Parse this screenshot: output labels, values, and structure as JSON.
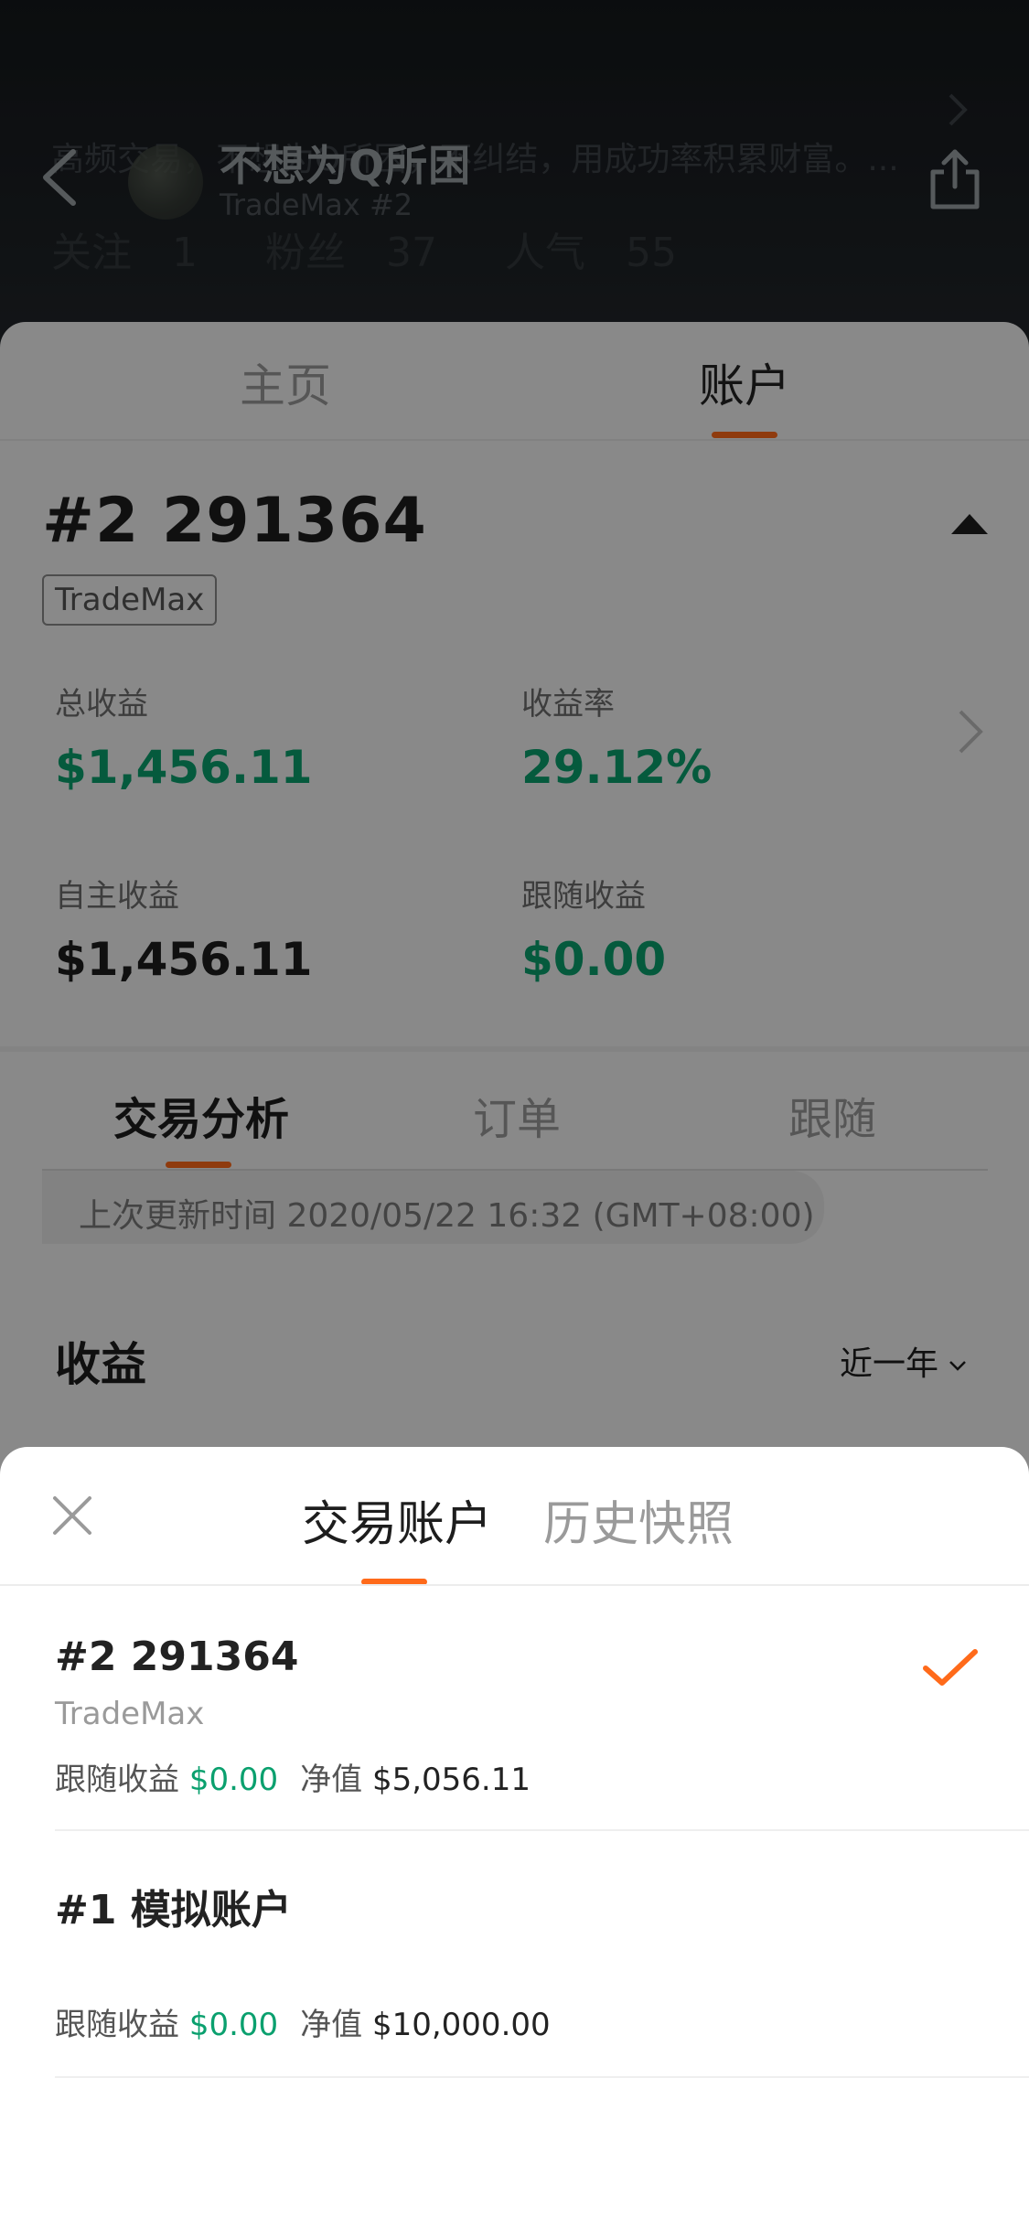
{
  "header": {
    "bio": "高频交易，不想为Q所困，不纠结，用成功率积累财富。...",
    "nickname": "不想为Q所困",
    "account_sub": "TradeMax #2",
    "stats": [
      {
        "label": "关注",
        "value": "1"
      },
      {
        "label": "粉丝",
        "value": "37"
      },
      {
        "label": "人气",
        "value": "55"
      }
    ],
    "icons": {
      "back": "chevron-left-icon",
      "share": "share-icon"
    }
  },
  "top_tabs": [
    {
      "label": "主页",
      "active": false
    },
    {
      "label": "账户",
      "active": true
    }
  ],
  "account": {
    "number": "#2 291364",
    "platform": "TradeMax",
    "metrics": [
      {
        "label": "总收益",
        "value": "$1,456.11",
        "color": "#0aa06e"
      },
      {
        "label": "收益率",
        "value": "29.12%",
        "color": "#0aa06e"
      },
      {
        "label": "自主收益",
        "value": "$1,456.11",
        "color": "#1d1d1d"
      },
      {
        "label": "跟随收益",
        "value": "$0.00",
        "color": "#0aa06e"
      }
    ]
  },
  "sub_tabs": [
    {
      "label": "交易分析",
      "active": true
    },
    {
      "label": "订单",
      "active": false
    },
    {
      "label": "跟随",
      "active": false
    }
  ],
  "update_time": "上次更新时间 2020/05/22 16:32 (GMT+08:00)",
  "earnings": {
    "title": "收益",
    "period": "近一年"
  },
  "sheet": {
    "tabs": [
      {
        "label": "交易账户",
        "active": true
      },
      {
        "label": "历史快照",
        "active": false
      }
    ],
    "accounts": [
      {
        "title": "#2 291364",
        "platform": "TradeMax",
        "follow_label": "跟随收益",
        "follow_value": "$0.00",
        "equity_label": "净值",
        "equity_value": "$5,056.11",
        "selected": true
      },
      {
        "title": "#1 模拟账户",
        "platform": "",
        "follow_label": "跟随收益",
        "follow_value": "$0.00",
        "equity_label": "净值",
        "equity_value": "$10,000.00",
        "selected": false
      }
    ]
  },
  "colors": {
    "accent": "#ff6a1a",
    "positive": "#0aa06e"
  }
}
